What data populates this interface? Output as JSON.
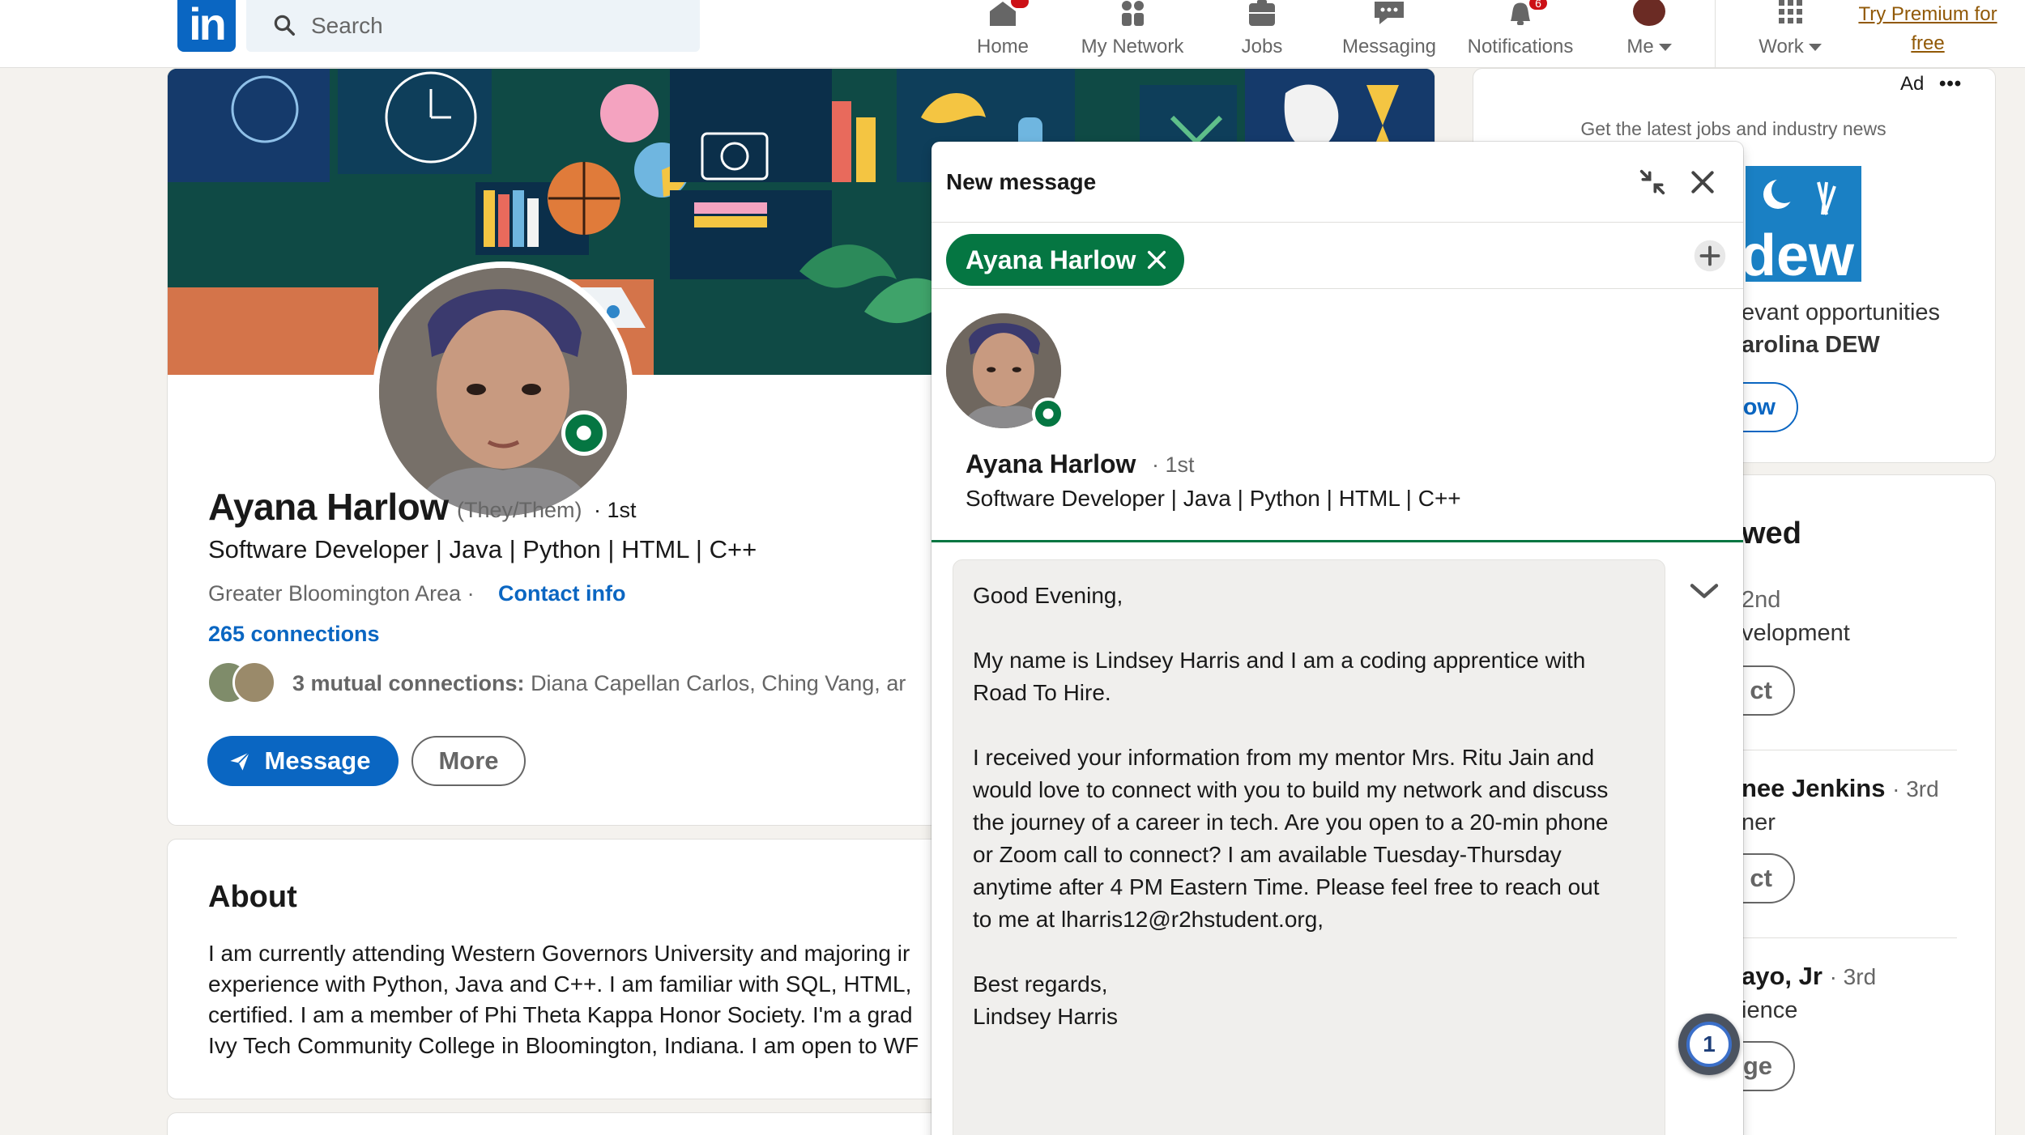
{
  "nav": {
    "search_placeholder": "Search",
    "items": [
      {
        "label": "Home",
        "badge": ""
      },
      {
        "label": "My Network",
        "badge": ""
      },
      {
        "label": "Jobs",
        "badge": ""
      },
      {
        "label": "Messaging",
        "badge": ""
      },
      {
        "label": "Notifications",
        "badge": "6"
      },
      {
        "label": "Me",
        "badge": ""
      },
      {
        "label": "Work",
        "badge": ""
      }
    ],
    "premium_line1": "Try Premium for",
    "premium_line2": "free"
  },
  "profile": {
    "name": "Ayana Harlow",
    "pronouns": "(They/Them)",
    "degree": "· 1st",
    "headline": "Software Developer | Java | Python | HTML | C++",
    "location": "Greater Bloomington Area ·",
    "contact_info": "Contact info",
    "connections": "265 connections",
    "mutual_prefix": "3 mutual connections:",
    "mutual_names": "Diana Capellan Carlos, Ching Vang, ar",
    "message_button": "Message",
    "more_button": "More"
  },
  "about": {
    "title": "About",
    "lines": [
      "I am currently attending Western Governors University and majoring ir",
      "experience with Python, Java and C++. I am familiar with SQL, HTML,",
      "certified. I am a member of Phi Theta Kappa Honor Society. I'm a grad",
      "Ivy Tech Community College in Bloomington, Indiana. I am open to WF"
    ]
  },
  "sidebar": {
    "ad_label": "Ad",
    "ad_more": "•••",
    "ad_subtitle": "Get the latest jobs and industry news",
    "ad_line1": "evant opportunities",
    "ad_line2": "arolina DEW",
    "ad_button": "ow",
    "viewed_title": "wed",
    "people": [
      {
        "line1": "2nd",
        "line2": "velopment",
        "button": "ct"
      },
      {
        "name": "nee Jenkins",
        "degree": "· 3rd",
        "line2": "ner",
        "button": "ct"
      },
      {
        "name": "ayo, Jr",
        "degree": "· 3rd",
        "line2": "ience",
        "button": "ge"
      }
    ]
  },
  "message": {
    "title": "New message",
    "recipient_chip": "Ayana Harlow",
    "recipient_name": "Ayana Harlow",
    "recipient_degree": "· 1st",
    "recipient_headline": "Software Developer | Java | Python | HTML | C++",
    "body": "Good Evening,\n\nMy name is Lindsey Harris and I am a coding apprentice with\nRoad To Hire.\n\nI received your information from my mentor Mrs. Ritu Jain and\nwould love to connect with you to build my network and discuss\nthe journey of a career in tech. Are you open to a 20-min phone\nor Zoom call to connect? I am available Tuesday-Thursday\nanytime after 4 PM Eastern Time. Please feel free to reach out\nto me at lharris12@r2hstudent.org,\n\nBest regards,\nLindsey Harris"
  },
  "extension_badge": "1",
  "colors": {
    "linkedin_blue": "#0a66c2",
    "online_green": "#057642",
    "notification_red": "#cc1016",
    "premium_gold": "#915907"
  },
  "icons": [
    "search-icon",
    "home-icon",
    "network-icon",
    "jobs-icon",
    "messaging-icon",
    "notifications-icon",
    "grid-icon",
    "send-icon",
    "minimize-icon",
    "close-icon",
    "add-icon",
    "chevron-down-icon"
  ]
}
